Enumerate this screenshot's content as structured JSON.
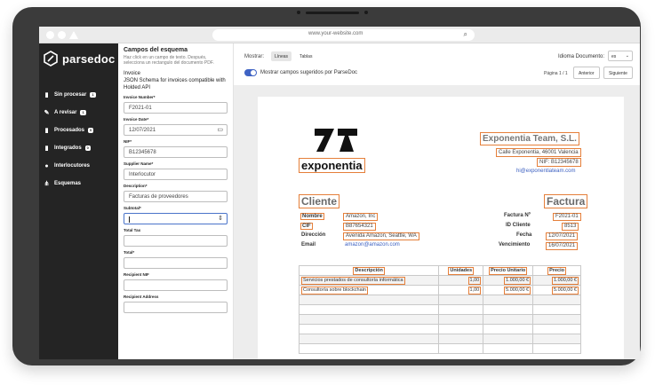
{
  "browser": {
    "url": "www.your-website.com"
  },
  "sidebar": {
    "logo_text": "parsedoc",
    "items": [
      {
        "label": "Sin procesar",
        "badge": "1",
        "icon": "file-icon"
      },
      {
        "label": "A revisar",
        "badge": "1",
        "icon": "edit-file-icon"
      },
      {
        "label": "Procesados",
        "badge": "0",
        "icon": "file-check-icon"
      },
      {
        "label": "Integrados",
        "badge": "0",
        "icon": "file-integrated-icon"
      },
      {
        "label": "Interlocutores",
        "badge": "",
        "icon": "user-circle-icon"
      },
      {
        "label": "Esquemas",
        "badge": "",
        "icon": "schema-icon"
      }
    ]
  },
  "schema": {
    "title": "Campos del esquema",
    "description": "Haz click en un campo de texto. Después, selecciona un rectangulo del documento PDF.",
    "doc_type": "Invoice",
    "json_schema": "JSON Schema for invoices compatible with Holded API",
    "fields": [
      {
        "label": "Invoice Number*",
        "value": "F2021-01"
      },
      {
        "label": "Invoice Date*",
        "value": "12/07/2021"
      },
      {
        "label": "NIF*",
        "value": "B12345678"
      },
      {
        "label": "Supplier Name*",
        "value": "Interlocutor"
      },
      {
        "label": "Description*",
        "value": "Facturas de proveedores"
      },
      {
        "label": "Subtotal*",
        "value": ""
      },
      {
        "label": "Total Tax",
        "value": ""
      },
      {
        "label": "Total*",
        "value": ""
      },
      {
        "label": "Recipient NIF",
        "value": ""
      },
      {
        "label": "Recipient Address",
        "value": ""
      }
    ]
  },
  "toolbar": {
    "show_label": "Mostrar:",
    "tab_lines": "Líneas",
    "tab_tables": "Tablas",
    "toggle_label": "Mostrar campos sugeridos por ParseDoc",
    "lang_label": "Idioma Documento:",
    "lang_value": "es",
    "page_label": "Página 1 / 1",
    "prev_label": "Anterior",
    "next_label": "Siguiente"
  },
  "invoice": {
    "logo_word": "exponentia",
    "company_name": "Exponentia Team, S.L.",
    "company_address": "Calle Exponentia, 46001 Valencia",
    "company_nif": "NIF: B12345678",
    "company_email": "hi@exponentiateam.com",
    "client_heading": "Cliente",
    "invoice_heading": "Factura",
    "client_rows": [
      {
        "label": "Nombre",
        "value": "Amazon, Inc"
      },
      {
        "label": "CIF",
        "value": "B87654321"
      },
      {
        "label": "Dirección",
        "value": "Avenida Amazon, Seattle, WA"
      },
      {
        "label": "Email",
        "value": "amazon@amazon.com"
      }
    ],
    "invoice_rows": [
      {
        "label": "Factura Nº",
        "value": "F2021-01"
      },
      {
        "label": "ID Cliente",
        "value": "8513"
      },
      {
        "label": "Fecha",
        "value": "12/07/2021"
      },
      {
        "label": "Vencimiento",
        "value": "16/07/2021"
      }
    ],
    "table_headers": [
      "Descripción",
      "Unidades",
      "Precio Unitario",
      "Precio"
    ],
    "lines": [
      {
        "desc": "Servicios prestados de consultoría informática",
        "units": "1,00",
        "unit_price": "1.000,00 €",
        "price": "1.000,00 €"
      },
      {
        "desc": "Consultoría sobre blockchain",
        "units": "1,00",
        "unit_price": "5.000,00 €",
        "price": "5.000,00 €"
      }
    ]
  }
}
